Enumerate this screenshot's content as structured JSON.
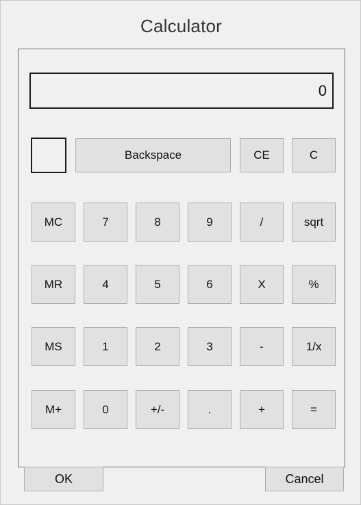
{
  "window": {
    "title": "Calculator"
  },
  "display": {
    "value": "0"
  },
  "buttons": {
    "backspace": "Backspace",
    "ce": "CE",
    "c": "C",
    "mc": "MC",
    "mr": "MR",
    "ms": "MS",
    "mplus": "M+",
    "seven": "7",
    "eight": "8",
    "nine": "9",
    "divide": "/",
    "sqrt": "sqrt",
    "four": "4",
    "five": "5",
    "six": "6",
    "multiply": "X",
    "percent": "%",
    "one": "1",
    "two": "2",
    "three": "3",
    "minus": "-",
    "reciprocal": "1/x",
    "zero": "0",
    "plusminus": "+/-",
    "dot": ".",
    "plus": "+",
    "equals": "="
  },
  "dialog": {
    "ok": "OK",
    "cancel": "Cancel"
  }
}
